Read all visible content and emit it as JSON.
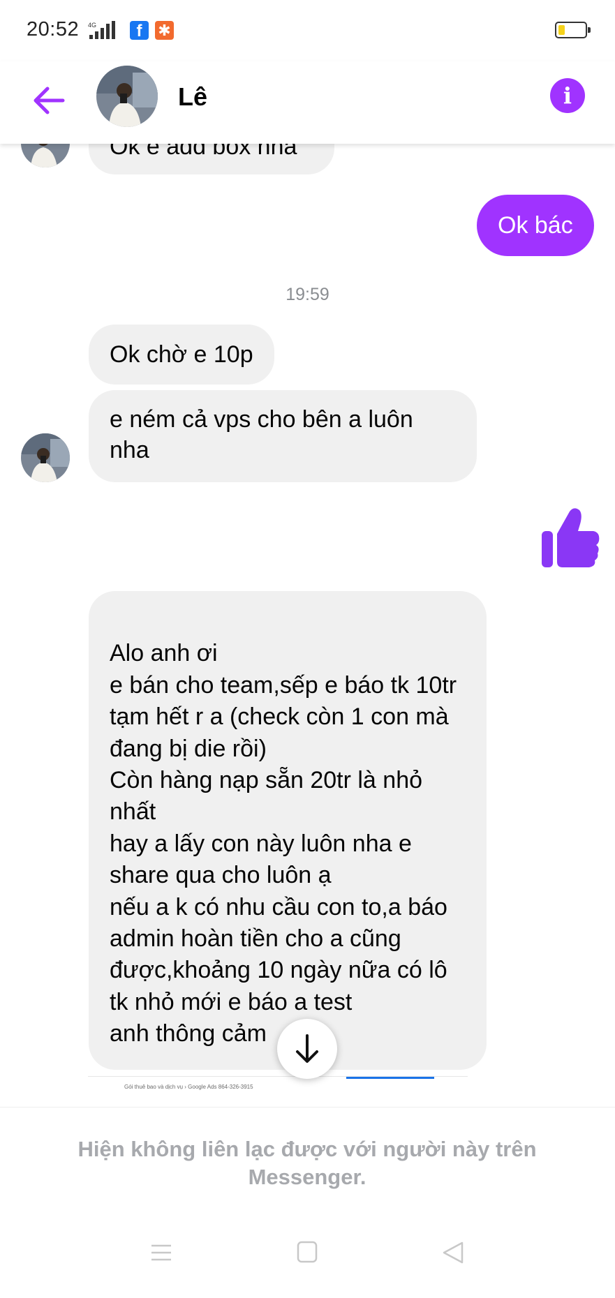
{
  "status_bar": {
    "time": "20:52",
    "network": "4G",
    "notification_icons": [
      "facebook-icon",
      "app-notification-icon"
    ],
    "battery_level": 0.25,
    "battery_color": "#f5d21a"
  },
  "header": {
    "contact_name": "Lê",
    "back_icon": "arrow-left-icon",
    "info_icon": "info-icon",
    "accent_color": "#a033ff"
  },
  "messages": {
    "partial_top": "Ok e add box nha",
    "sent_1": "Ok bác",
    "timestamp": "19:59",
    "received_1": "Ok chờ e 10p",
    "received_2": "e ném cả vps cho bên a luôn nha",
    "sent_like": "thumbs-up-icon",
    "received_long": "Alo anh ơi\ne bán cho team,sếp e báo tk 10tr tạm hết r a (check còn 1 con mà đang bị die rồi)\nCòn hàng nạp sẵn 20tr là nhỏ nhất\nhay a lấy con này luôn nha e share qua cho luôn ạ\nnếu a k có nhu cầu con to,a báo admin hoàn tiền cho a cũng được,khoảng 10 ngày nữa có lô tk nhỏ mới e báo a test\nanh thông cảm",
    "attachment_preview_text": "Gói thuê bao và dịch vụ  ›  Google Ads 864-326-3915"
  },
  "footer": {
    "notice": "Hiện không liên lạc được với người này trên Messenger."
  },
  "nav_bar": {
    "icons": [
      "menu-icon",
      "home-icon",
      "back-triangle-icon"
    ]
  }
}
